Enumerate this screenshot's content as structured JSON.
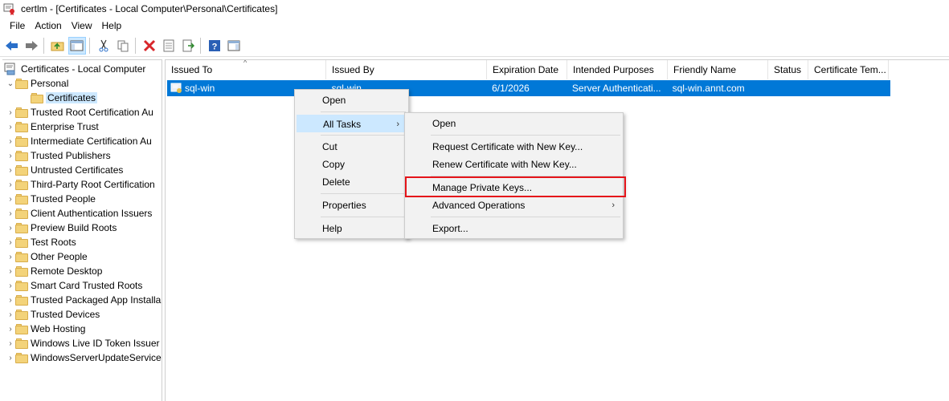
{
  "window": {
    "title": "certlm - [Certificates - Local Computer\\Personal\\Certificates]"
  },
  "menubar": {
    "items": [
      "File",
      "Action",
      "View",
      "Help"
    ]
  },
  "toolbar": {
    "icons": [
      "back-arrow-icon",
      "forward-arrow-icon",
      "up-folder-icon",
      "show-hide-tree-icon",
      "cut-icon",
      "copy-icon",
      "delete-icon",
      "properties-icon",
      "export-list-icon",
      "help-icon",
      "action-pane-icon"
    ]
  },
  "tree": {
    "root": "Certificates - Local Computer",
    "items": [
      {
        "label": "Personal",
        "expanded": true
      },
      {
        "label": "Certificates",
        "selected": true
      },
      {
        "label": "Trusted Root Certification Au"
      },
      {
        "label": "Enterprise Trust"
      },
      {
        "label": "Intermediate Certification Au"
      },
      {
        "label": "Trusted Publishers"
      },
      {
        "label": "Untrusted Certificates"
      },
      {
        "label": "Third-Party Root Certification"
      },
      {
        "label": "Trusted People"
      },
      {
        "label": "Client Authentication Issuers"
      },
      {
        "label": "Preview Build Roots"
      },
      {
        "label": "Test Roots"
      },
      {
        "label": "Other People"
      },
      {
        "label": "Remote Desktop"
      },
      {
        "label": "Smart Card Trusted Roots"
      },
      {
        "label": "Trusted Packaged App Installa"
      },
      {
        "label": "Trusted Devices"
      },
      {
        "label": "Web Hosting"
      },
      {
        "label": "Windows Live ID Token Issuer"
      },
      {
        "label": "WindowsServerUpdateService"
      }
    ]
  },
  "list": {
    "columns": [
      "Issued To",
      "Issued By",
      "Expiration Date",
      "Intended Purposes",
      "Friendly Name",
      "Status",
      "Certificate Tem..."
    ],
    "rows": [
      {
        "issued_to": "sql-win",
        "issued_by": "sql-win",
        "expiration": "6/1/2026",
        "purposes": "Server Authenticati...",
        "friendly_name": "sql-win.annt.com",
        "status": "",
        "template": ""
      }
    ]
  },
  "context_menu": {
    "items": [
      "Open",
      "All Tasks",
      "Cut",
      "Copy",
      "Delete",
      "Properties",
      "Help"
    ],
    "highlighted": "All Tasks"
  },
  "submenu": {
    "items": [
      "Open",
      "Request Certificate with New Key...",
      "Renew Certificate with New Key...",
      "Manage Private Keys...",
      "Advanced Operations",
      "Export..."
    ],
    "emphasized": "Manage Private Keys..."
  },
  "colors": {
    "selection": "#0078d7",
    "menu_hover": "#cce8ff",
    "annotation": "#e5141a"
  }
}
